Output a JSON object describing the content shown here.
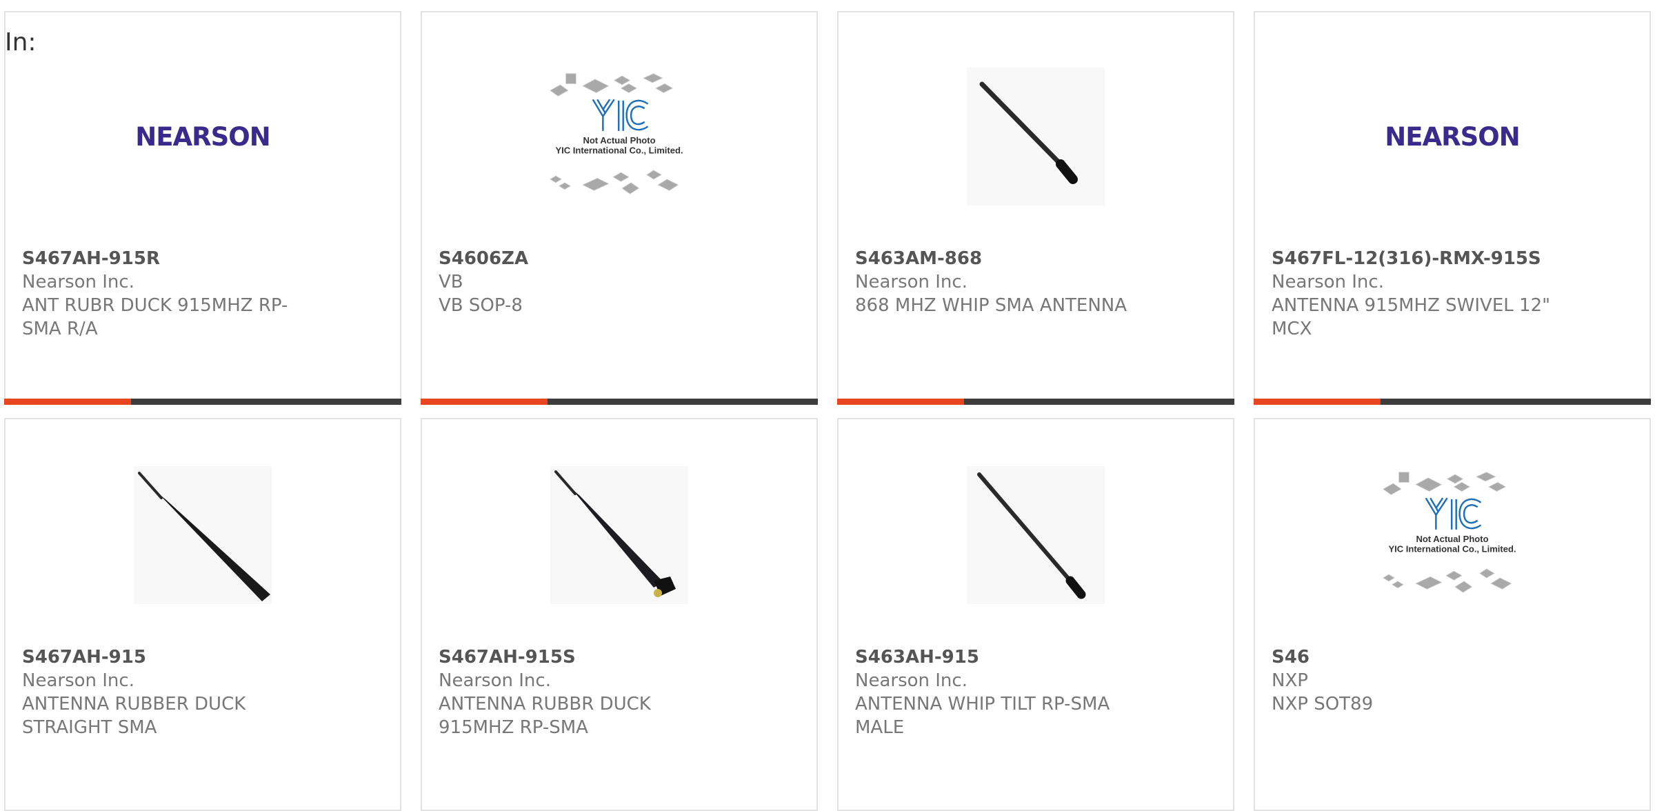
{
  "filter": {
    "label": "In:"
  },
  "colors": {
    "accent": "#e8461e",
    "bar": "#3d3d3d",
    "brand_nearson": "#3a2a8c",
    "yic_blue": "#1e6fb8"
  },
  "products": [
    {
      "part_number": "S467AH-915R",
      "manufacturer": "Nearson Inc.",
      "description": "ANT RUBR DUCK 915MHZ RP-SMA R/A",
      "image": "nearson-logo",
      "logo_text": "NEARSON"
    },
    {
      "part_number": "S4606ZA",
      "manufacturer": "VB",
      "description": "VB SOP-8",
      "image": "yic-placeholder",
      "note_line1": "Not Actual Photo",
      "note_line2": "YIC International Co., Limited."
    },
    {
      "part_number": "S463AM-868",
      "manufacturer": "Nearson Inc.",
      "description": "868 MHZ WHIP SMA ANTENNA",
      "image": "antenna-whip"
    },
    {
      "part_number": "S467FL-12(316)-RMX-915S",
      "manufacturer": "Nearson Inc.",
      "description": "ANTENNA 915MHZ SWIVEL 12\" MCX",
      "image": "nearson-logo",
      "logo_text": "NEARSON"
    },
    {
      "part_number": "S467AH-915",
      "manufacturer": "Nearson Inc.",
      "description": "ANTENNA RUBBER DUCK STRAIGHT SMA",
      "image": "antenna-rubber-duck"
    },
    {
      "part_number": "S467AH-915S",
      "manufacturer": "Nearson Inc.",
      "description": "ANTENNA RUBBR DUCK 915MHZ RP-SMA",
      "image": "antenna-right-angle"
    },
    {
      "part_number": "S463AH-915",
      "manufacturer": "Nearson Inc.",
      "description": "ANTENNA WHIP TILT RP-SMA MALE",
      "image": "antenna-whip"
    },
    {
      "part_number": "S46",
      "manufacturer": "NXP",
      "description": "NXP SOT89",
      "image": "yic-placeholder",
      "note_line1": "Not Actual Photo",
      "note_line2": "YIC International Co., Limited."
    }
  ]
}
